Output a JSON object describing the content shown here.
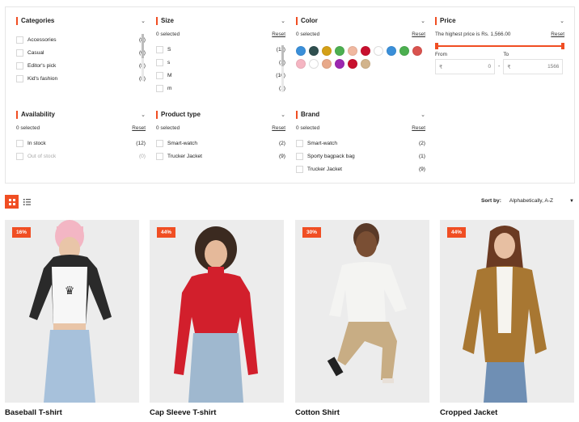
{
  "filters": {
    "categories": {
      "title": "Categories",
      "items": [
        {
          "label": "Accessories",
          "count": "(8)"
        },
        {
          "label": "Casual",
          "count": "(6)"
        },
        {
          "label": "Editor's pick",
          "count": "(8)"
        },
        {
          "label": "Kid's fashion",
          "count": "(8)"
        }
      ]
    },
    "size": {
      "title": "Size",
      "selected": "0 selected",
      "reset": "Reset",
      "items": [
        {
          "label": "S",
          "count": "(11)"
        },
        {
          "label": "s",
          "count": "(1)"
        },
        {
          "label": "M",
          "count": "(10)"
        },
        {
          "label": "m",
          "count": "(1)"
        }
      ]
    },
    "color": {
      "title": "Color",
      "selected": "0 selected",
      "reset": "Reset",
      "swatches": [
        "#3a8fd9",
        "#2f4f4f",
        "#d4a017",
        "#4caf50",
        "#f0b8a0",
        "#c8102e",
        "#ffffff",
        "#3a8fd9",
        "#4caf50",
        "#d9534f",
        "#f5b5c2",
        "#ffffff",
        "#e8a98a",
        "#9c27b0",
        "#c8102e",
        "#d2b48c"
      ]
    },
    "price": {
      "title": "Price",
      "note": "The highest price is Rs. 1,566.00",
      "reset": "Reset",
      "from_label": "From",
      "to_label": "To",
      "currency": "₹",
      "from_placeholder": "0",
      "to_placeholder": "1566"
    },
    "availability": {
      "title": "Availability",
      "selected": "0 selected",
      "reset": "Reset",
      "items": [
        {
          "label": "In stock",
          "count": "(12)"
        },
        {
          "label": "Out of stock",
          "count": "(0)"
        }
      ]
    },
    "product_type": {
      "title": "Product type",
      "selected": "0 selected",
      "reset": "Reset",
      "items": [
        {
          "label": "Smart-watch",
          "count": "(2)"
        },
        {
          "label": "Trucker Jacket",
          "count": "(9)"
        }
      ]
    },
    "brand": {
      "title": "Brand",
      "selected": "0 selected",
      "reset": "Reset",
      "items": [
        {
          "label": "Smart-watch",
          "count": "(2)"
        },
        {
          "label": "Sporty bagpack bag",
          "count": "(1)"
        },
        {
          "label": "Trucker Jacket",
          "count": "(9)"
        }
      ]
    }
  },
  "sort": {
    "label": "Sort by:",
    "value": "Alphabetically, A-Z"
  },
  "products": [
    {
      "name": "Baseball T-shirt",
      "badge": "16%"
    },
    {
      "name": "Cap Sleeve T-shirt",
      "badge": "44%"
    },
    {
      "name": "Cotton Shirt",
      "badge": "30%"
    },
    {
      "name": "Cropped Jacket",
      "badge": "44%"
    }
  ],
  "colors": {
    "accent": "#f04e23"
  }
}
